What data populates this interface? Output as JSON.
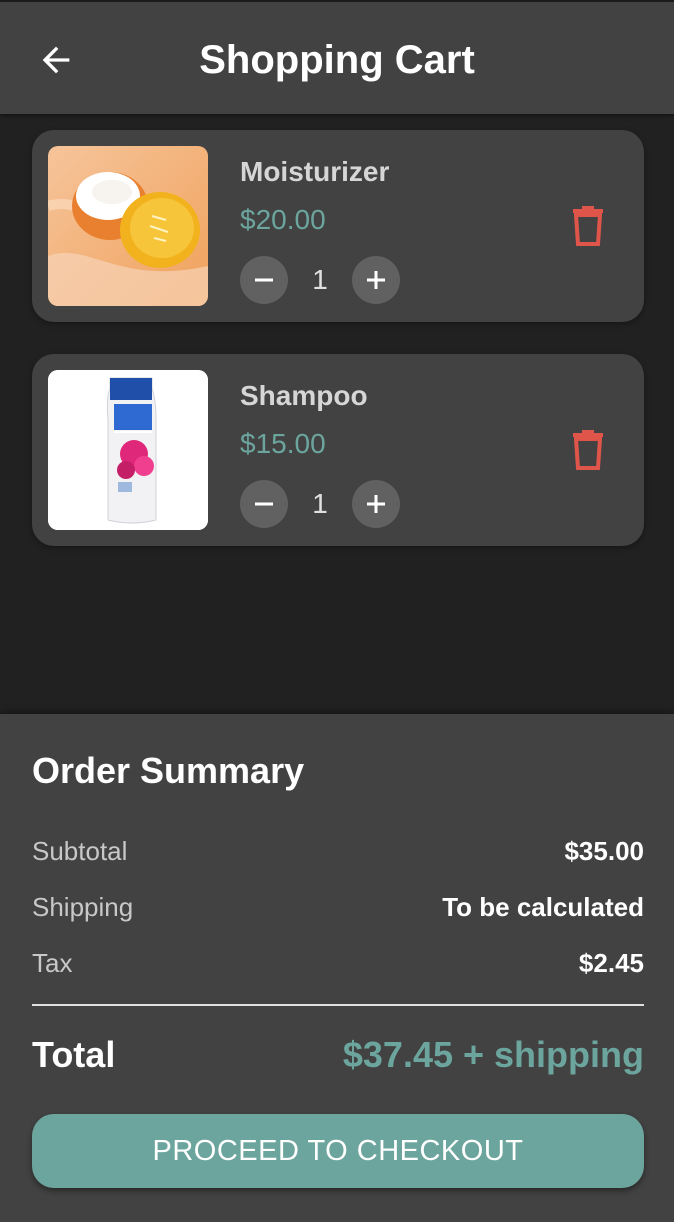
{
  "appbar": {
    "title": "Shopping Cart",
    "back_icon": "arrow-left-icon"
  },
  "cart": {
    "items": [
      {
        "name": "Moisturizer",
        "price": "$20.00",
        "quantity": "1",
        "image_icon": "moisturizer-jar-image"
      },
      {
        "name": "Shampoo",
        "price": "$15.00",
        "quantity": "1",
        "image_icon": "shampoo-bottle-image"
      }
    ]
  },
  "summary": {
    "title": "Order Summary",
    "subtotal_label": "Subtotal",
    "subtotal_value": "$35.00",
    "shipping_label": "Shipping",
    "shipping_value": "To be calculated",
    "tax_label": "Tax",
    "tax_value": "$2.45",
    "total_label": "Total",
    "total_value": "$37.45 + shipping",
    "checkout_label": "PROCEED TO CHECKOUT"
  },
  "colors": {
    "background": "#212121",
    "surface": "#424242",
    "accent": "#6ca59d",
    "delete": "#e0554a"
  }
}
